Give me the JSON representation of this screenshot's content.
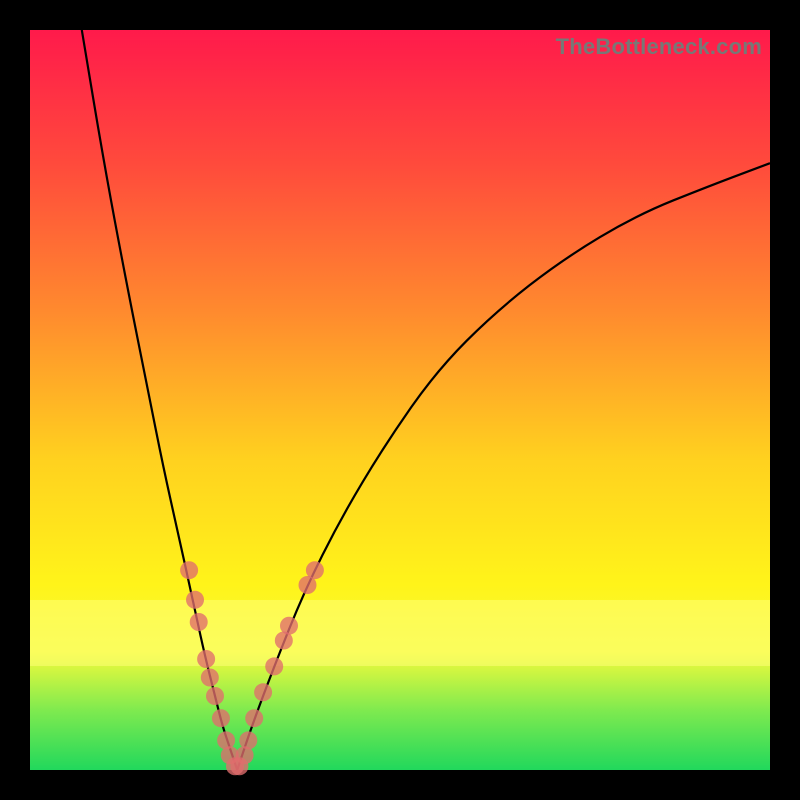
{
  "watermark": "TheBottleneck.com",
  "chart_data": {
    "type": "line",
    "title": "",
    "xlabel": "",
    "ylabel": "",
    "xlim": [
      0,
      100
    ],
    "ylim": [
      0,
      100
    ],
    "grid": false,
    "legend": false,
    "series": [
      {
        "name": "left-curve",
        "x": [
          7,
          10,
          13,
          16,
          18,
          20,
          22,
          23.5,
          25,
          26,
          27,
          28
        ],
        "y": [
          100,
          82,
          66,
          51,
          41,
          32,
          23,
          16,
          10,
          6,
          3,
          0
        ]
      },
      {
        "name": "right-curve",
        "x": [
          28,
          30,
          33,
          37,
          42,
          48,
          55,
          63,
          72,
          82,
          92,
          100
        ],
        "y": [
          0,
          6,
          14,
          24,
          34,
          44,
          54,
          62,
          69,
          75,
          79,
          82
        ]
      }
    ],
    "markers": {
      "name": "highlighted-points",
      "color": "#e06d6d",
      "points": [
        {
          "x": 21.5,
          "y": 27
        },
        {
          "x": 22.3,
          "y": 23
        },
        {
          "x": 22.8,
          "y": 20
        },
        {
          "x": 23.8,
          "y": 15
        },
        {
          "x": 24.3,
          "y": 12.5
        },
        {
          "x": 25.0,
          "y": 10
        },
        {
          "x": 25.8,
          "y": 7
        },
        {
          "x": 26.5,
          "y": 4
        },
        {
          "x": 27.0,
          "y": 2
        },
        {
          "x": 27.7,
          "y": 0.5
        },
        {
          "x": 28.3,
          "y": 0.5
        },
        {
          "x": 29.0,
          "y": 2
        },
        {
          "x": 29.5,
          "y": 4
        },
        {
          "x": 30.3,
          "y": 7
        },
        {
          "x": 31.5,
          "y": 10.5
        },
        {
          "x": 33.0,
          "y": 14
        },
        {
          "x": 34.3,
          "y": 17.5
        },
        {
          "x": 35.0,
          "y": 19.5
        },
        {
          "x": 37.5,
          "y": 25
        },
        {
          "x": 38.5,
          "y": 27
        }
      ]
    },
    "highlight_band": {
      "y_from": 14,
      "y_to": 23
    }
  }
}
